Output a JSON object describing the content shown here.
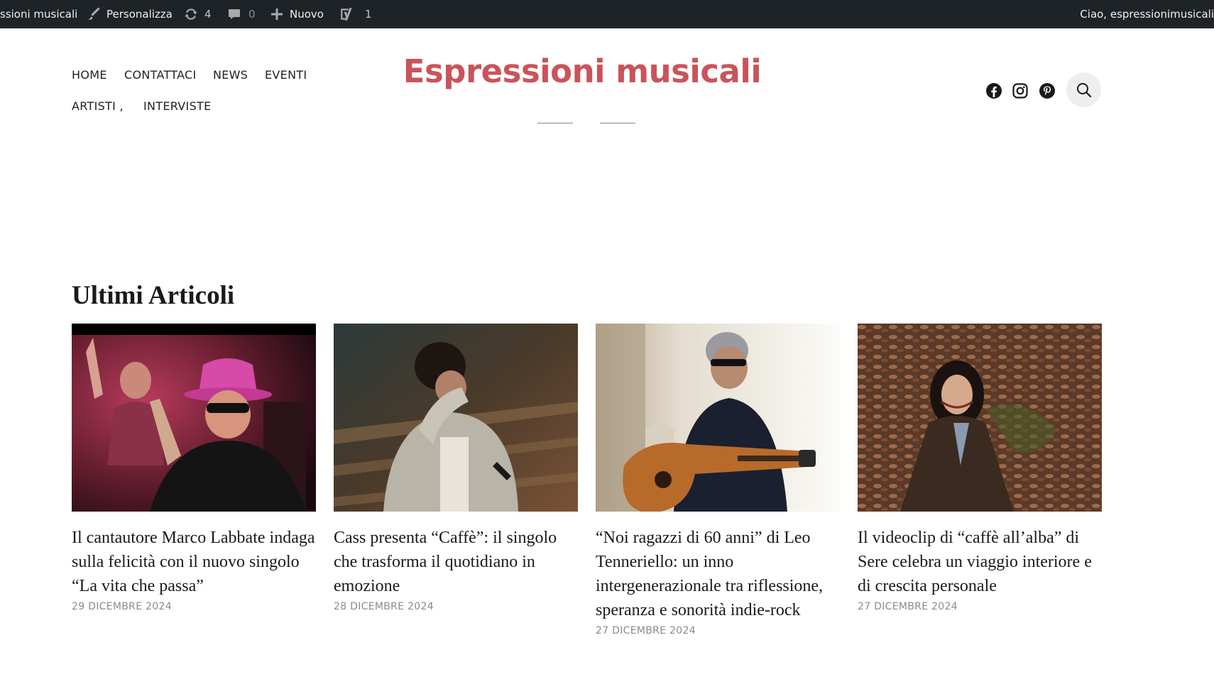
{
  "admin_bar": {
    "site_name": "ssioni musicali",
    "customize": "Personalizza",
    "updates_count": "4",
    "comments_count": "0",
    "new_label": "Nuovo",
    "yoast_count": "1",
    "greeting": "Ciao, espressionimusicali"
  },
  "header": {
    "site_title": "Espressioni musicali",
    "title_color": "#c9545a",
    "nav": [
      "HOME",
      "CONTATTACI",
      "NEWS",
      "EVENTI",
      "ARTISTI ,",
      "INTERVISTE"
    ],
    "social_icons": [
      "facebook-icon",
      "instagram-icon",
      "pinterest-icon"
    ],
    "search_icon": "search-icon"
  },
  "section": {
    "title": "Ultimi Articoli"
  },
  "articles": [
    {
      "title": "Il cantautore Marco Labbate indaga sulla felicità con il nuovo singolo “La vita che passa”",
      "date": "29 DICEMBRE 2024"
    },
    {
      "title": "Cass presenta “Caffè”: il singolo che trasforma il quotidiano in emozione",
      "date": "28 DICEMBRE 2024"
    },
    {
      "title": "“Noi ragazzi di 60 anni” di Leo Tenneriello: un inno intergenerazionale tra riflessione, speranza e sonorità indie-rock",
      "date": "27 DICEMBRE 2024"
    },
    {
      "title": "Il videoclip di “caffè all’alba” di Sere celebra un viaggio interiore e di crescita personale",
      "date": "27 DICEMBRE 2024"
    }
  ]
}
